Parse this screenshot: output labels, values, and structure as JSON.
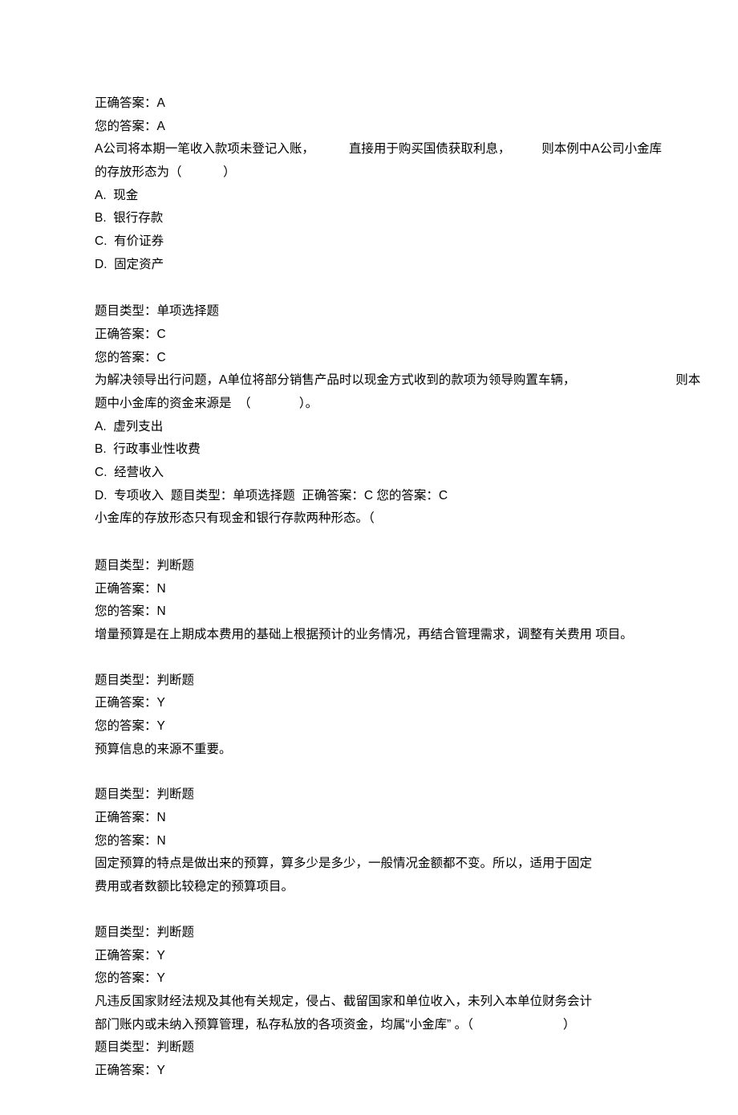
{
  "q0": {
    "correct": "正确答案：A",
    "yours": "您的答案：A"
  },
  "q1": {
    "stem_a": "A公司将本期一笔收入款项未登记入账，",
    "stem_b": "直接用于购买国债获取利息，",
    "stem_c": "则本例中A公司小金库",
    "stem2": "的存放形态为（            ）",
    "opt_a": "A.  现金",
    "opt_b": "B.  银行存款",
    "opt_c": "C.  有价证券",
    "opt_d": "D.  固定资产",
    "type": "题目类型：单项选择题",
    "correct": "正确答案：C",
    "yours": "您的答案：C"
  },
  "q2": {
    "stem_a": "为解决领导出行问题，A单位将部分销售产品时以现金方式收到的款项为领导购置车辆，",
    "stem_b": "则本",
    "stem2": "题中小金库的资金来源是  （              ）。",
    "opt_a": "A.  虚列支出",
    "opt_b": "B.  行政事业性收费",
    "opt_c": "C.  经营收入",
    "opt_d": "D.  专项收入  题目类型：单项选择题  正确答案：C 您的答案：C"
  },
  "q3": {
    "stem": "小金库的存放形态只有现金和银行存款两种形态。（",
    "type": "题目类型：判断题",
    "correct": "正确答案：N",
    "yours": "您的答案：N"
  },
  "q4": {
    "stem": "增量预算是在上期成本费用的基础上根据预计的业务情况，再结合管理需求，调整有关费用 项目。",
    "type": "题目类型：判断题",
    "correct": "正确答案：Y",
    "yours": "您的答案：Y"
  },
  "q5": {
    "stem": "预算信息的来源不重要。",
    "type": "题目类型：判断题",
    "correct": "正确答案：N",
    "yours": "您的答案：N"
  },
  "q6": {
    "stem1": "固定预算的特点是做出来的预算，算多少是多少，一般情况金额都不变。所以，适用于固定",
    "stem2": "费用或者数额比较稳定的预算项目。",
    "type": "题目类型：判断题",
    "correct": "正确答案：Y",
    "yours": "您的答案：Y"
  },
  "q7": {
    "stem1_a": "凡违反国家财经法规及其他有关规定，侵占、截留国家和单位收入，未列入本单位财务会计",
    "stem2_a": "部门账内或未纳入预算管理，私存私放的各项资金，均属“小金库” 。（",
    "stem2_b": "）",
    "type": "题目类型：判断题",
    "correct": "正确答案：Y"
  }
}
